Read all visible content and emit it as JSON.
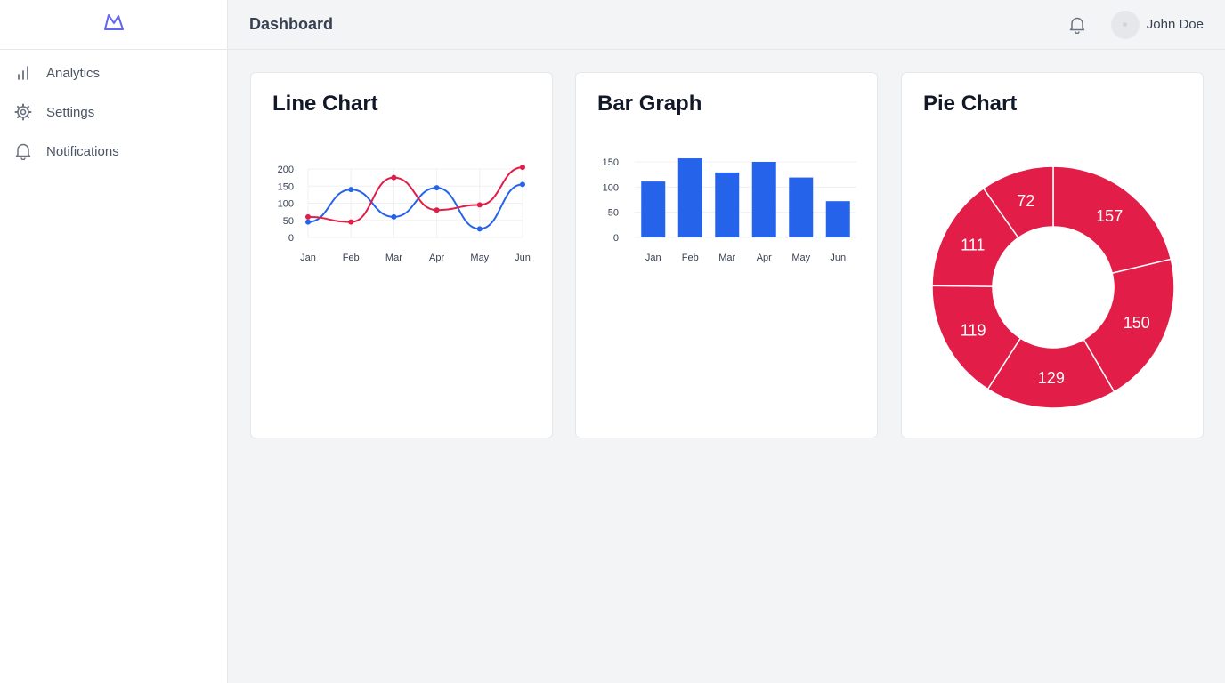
{
  "sidebar": {
    "logo_icon": "mountain-logo-icon",
    "items": [
      {
        "label": "Analytics",
        "icon": "bar-chart-icon"
      },
      {
        "label": "Settings",
        "icon": "gear-icon"
      },
      {
        "label": "Notifications",
        "icon": "bell-icon"
      }
    ]
  },
  "header": {
    "title": "Dashboard",
    "bell_icon": "bell-icon",
    "user_name": "John Doe"
  },
  "colors": {
    "brand": "#6366f1",
    "blue": "#2563eb",
    "red": "#e11d48"
  },
  "cards": {
    "line": {
      "title": "Line Chart"
    },
    "bar": {
      "title": "Bar Graph"
    },
    "pie": {
      "title": "Pie Chart"
    }
  },
  "chart_data": [
    {
      "type": "line",
      "categories": [
        "Jan",
        "Feb",
        "Mar",
        "Apr",
        "May",
        "Jun"
      ],
      "ylim": [
        0,
        200
      ],
      "yticks": [
        0,
        50,
        100,
        150,
        200
      ],
      "grid": true,
      "series": [
        {
          "color": "#2563eb",
          "values": [
            45,
            140,
            60,
            145,
            25,
            155
          ]
        },
        {
          "color": "#e11d48",
          "values": [
            60,
            45,
            175,
            80,
            95,
            205
          ]
        }
      ]
    },
    {
      "type": "bar",
      "categories": [
        "Jan",
        "Feb",
        "Mar",
        "Apr",
        "May",
        "Jun"
      ],
      "ylim": [
        0,
        150
      ],
      "yticks": [
        0,
        50,
        100,
        150
      ],
      "grid": true,
      "color": "#2563eb",
      "values": [
        111,
        157,
        129,
        150,
        119,
        72
      ]
    },
    {
      "type": "pie",
      "donut": true,
      "color": "#e11d48",
      "values": [
        157,
        150,
        129,
        119,
        111,
        72
      ]
    }
  ]
}
